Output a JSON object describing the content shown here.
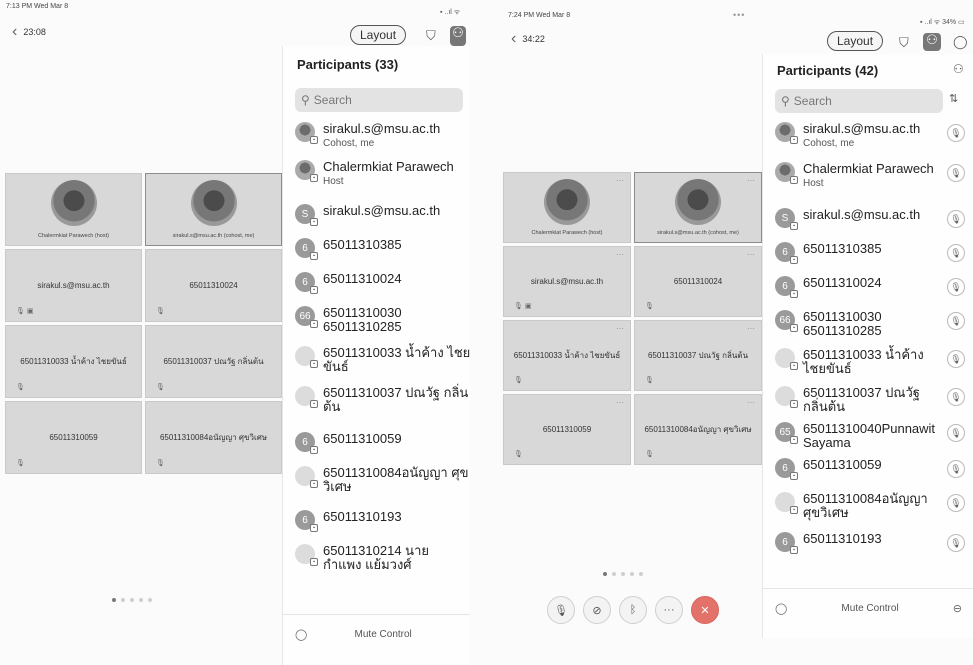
{
  "left": {
    "status_time": "7:13 PM  Wed Mar 8",
    "status_right": "▪ ..ıl ᯤ",
    "timer": "23:08",
    "layout_label": "Layout",
    "sidebar": {
      "title": "Participants (33)",
      "search_placeholder": "Search",
      "participants": [
        {
          "avatar": "",
          "name": "sirakul.s@msu.ac.th",
          "sub": "Cohost, me"
        },
        {
          "avatar": "",
          "name": "Chalermkiat Parawech",
          "sub": "Host"
        },
        {
          "avatar": "S",
          "name": "sirakul.s@msu.ac.th",
          "sub": ""
        },
        {
          "avatar": "6",
          "name": "65011310385",
          "sub": ""
        },
        {
          "avatar": "6",
          "name": "65011310024",
          "sub": ""
        },
        {
          "avatar": "66",
          "name": "65011310030 65011310285",
          "sub": ""
        },
        {
          "avatar": "",
          "name": "65011310033 น้ำค้าง ไชยขันธ์",
          "sub": ""
        },
        {
          "avatar": "",
          "name": "65011310037 ปณวัฐ กลิ่นต้น",
          "sub": ""
        },
        {
          "avatar": "6",
          "name": "65011310059",
          "sub": ""
        },
        {
          "avatar": "",
          "name": "65011310084อนัญญา ศุขวิเศษ",
          "sub": ""
        },
        {
          "avatar": "6",
          "name": "65011310193",
          "sub": ""
        },
        {
          "avatar": "",
          "name": "65011310214 นาย กำแพง แย้มวงศ์",
          "sub": ""
        }
      ],
      "footer_label": "Mute Control"
    },
    "tiles": [
      {
        "name": "",
        "caption": "Chalermkiat Parawech (host)",
        "photo": true
      },
      {
        "name": "",
        "caption": "sirakul.s@msu.ac.th (cohost, me)",
        "photo": true
      },
      {
        "name": "sirakul.s@msu.ac.th",
        "caption": "",
        "photo": false
      },
      {
        "name": "65011310024",
        "caption": "",
        "photo": false
      },
      {
        "name": "65011310033 น้ำค้าง ไชยขันธ์",
        "caption": "",
        "photo": false
      },
      {
        "name": "65011310037 ปณวัฐ กลิ่นต้น",
        "caption": "",
        "photo": false
      },
      {
        "name": "65011310059",
        "caption": "",
        "photo": false
      },
      {
        "name": "65011310084อนัญญา ศุขวิเศษ",
        "caption": "",
        "photo": false
      }
    ],
    "page_dots": 5,
    "active_dot": 0
  },
  "right": {
    "status_time": "7:24 PM  Wed Mar 8",
    "status_right": "▪ ..ıl ᯤ 34% ▭",
    "timer": "34:22",
    "ellipsis": "•••",
    "layout_label": "Layout",
    "sidebar": {
      "title": "Participants (42)",
      "search_placeholder": "Search",
      "participants": [
        {
          "avatar": "",
          "name": "sirakul.s@msu.ac.th",
          "sub": "Cohost, me"
        },
        {
          "avatar": "",
          "name": "Chalermkiat Parawech",
          "sub": "Host"
        },
        {
          "avatar": "S",
          "name": "sirakul.s@msu.ac.th",
          "sub": ""
        },
        {
          "avatar": "6",
          "name": "65011310385",
          "sub": ""
        },
        {
          "avatar": "6",
          "name": "65011310024",
          "sub": ""
        },
        {
          "avatar": "66",
          "name": "65011310030 65011310285",
          "sub": ""
        },
        {
          "avatar": "",
          "name": "65011310033 น้ำค้าง ไชยขันธ์",
          "sub": ""
        },
        {
          "avatar": "",
          "name": "65011310037 ปณวัฐ กลิ่นต้น",
          "sub": ""
        },
        {
          "avatar": "65",
          "name": "65011310040Punnawit Sayama",
          "sub": ""
        },
        {
          "avatar": "6",
          "name": "65011310059",
          "sub": ""
        },
        {
          "avatar": "",
          "name": "65011310084อนัญญา ศุขวิเศษ",
          "sub": ""
        },
        {
          "avatar": "6",
          "name": "65011310193",
          "sub": ""
        }
      ],
      "footer_label": "Mute Control"
    },
    "tiles": [
      {
        "name": "",
        "caption": "Chalermkiat Parawech (host)",
        "photo": true
      },
      {
        "name": "",
        "caption": "sirakul.s@msu.ac.th (cohost, me)",
        "photo": true
      },
      {
        "name": "sirakul.s@msu.ac.th",
        "caption": "",
        "photo": false
      },
      {
        "name": "65011310024",
        "caption": "",
        "photo": false
      },
      {
        "name": "65011310033 น้ำค้าง ไชยขันธ์",
        "caption": "",
        "photo": false
      },
      {
        "name": "65011310037 ปณวัฐ กลิ่นต้น",
        "caption": "",
        "photo": false
      },
      {
        "name": "65011310059",
        "caption": "",
        "photo": false
      },
      {
        "name": "65011310084อนัญญา ศุขวิเศษ",
        "caption": "",
        "photo": false
      }
    ],
    "page_dots": 5,
    "active_dot": 0,
    "controls": [
      {
        "icon": "mic-icon",
        "glyph": "🎙"
      },
      {
        "icon": "video-off-icon",
        "glyph": "⊘"
      },
      {
        "icon": "bluetooth-icon",
        "glyph": "ᛒ"
      },
      {
        "icon": "more-icon",
        "glyph": "···"
      },
      {
        "icon": "end-call-icon",
        "glyph": "✕"
      }
    ]
  },
  "colors": {
    "end_call": "#e2726a",
    "tile_bg": "#d8d8d8",
    "search_bg": "#e3e3e3"
  }
}
